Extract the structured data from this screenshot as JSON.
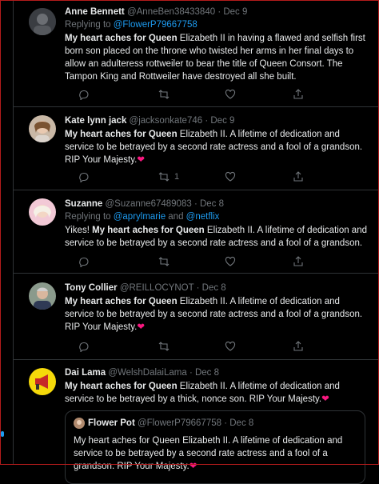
{
  "tweets": [
    {
      "name": "Anne Bennett",
      "handle": "@AnneBen38433840",
      "date": "· Dec 9",
      "reply_prefix": "Replying to ",
      "reply_to": "@FlowerP79667758",
      "text_bold": "My heart aches for Queen",
      "text_rest": " Elizabeth II in having a flawed and selfish first born son placed on the throne who twisted her arms in her final days to allow an adulteress rottweiler to bear the title of Queen Consort. The Tampon King and Rottweiler have destroyed all she built.",
      "retweets": "",
      "heart": ""
    },
    {
      "name": "Kate lynn jack",
      "handle": "@jacksonkate746",
      "date": "· Dec 9",
      "text_bold": "My heart aches for Queen",
      "text_rest": " Elizabeth II.  A lifetime of dedication and service to be betrayed by a second rate actress and a fool of a grandson. RIP Your Majesty.",
      "retweets": "1",
      "heart": "❤"
    },
    {
      "name": "Suzanne",
      "handle": "@Suzanne67489083",
      "date": "· Dec 8",
      "reply_prefix": "Replying to ",
      "reply_to": "@aprylmarie",
      "reply_and": " and ",
      "reply_to2": "@netflix",
      "text_pre": "Yikes! ",
      "text_bold": "My heart aches for Queen",
      "text_rest": " Elizabeth II.  A lifetime of dedication and service to be betrayed by a second rate actress and a fool of a grandson.",
      "retweets": "",
      "heart": ""
    },
    {
      "name": "Tony Collier",
      "handle": "@REILLOCYNOT",
      "date": "· Dec 8",
      "text_bold": "My heart aches for Queen",
      "text_rest": " Elizabeth II.  A lifetime of dedication and service to be betrayed by a second rate actress and a fool of a grandson. RIP Your Majesty.",
      "retweets": "",
      "heart": "❤"
    },
    {
      "name": "Dai Lama",
      "handle": "@WelshDalaiLama",
      "date": "· Dec 8",
      "text_bold": "My heart aches for Queen",
      "text_rest": " Elizabeth II.  A lifetime of dedication and service to be betrayed by a thick, nonce son. RIP Your Majesty.",
      "heart": "❤"
    }
  ],
  "quote": {
    "name": "Flower Pot",
    "handle": "@FlowerP79667758",
    "date": "· Dec 8",
    "text": "My heart aches for Queen Elizabeth II.  A lifetime of dedication and service to be betrayed by a second rate actress and a fool of a grandson.  RIP Your Majesty.",
    "heart": "❤"
  },
  "colors": {
    "accent": "#1d9bf0",
    "heart": "#f91880",
    "background": "#000000",
    "muted": "#71767b"
  }
}
